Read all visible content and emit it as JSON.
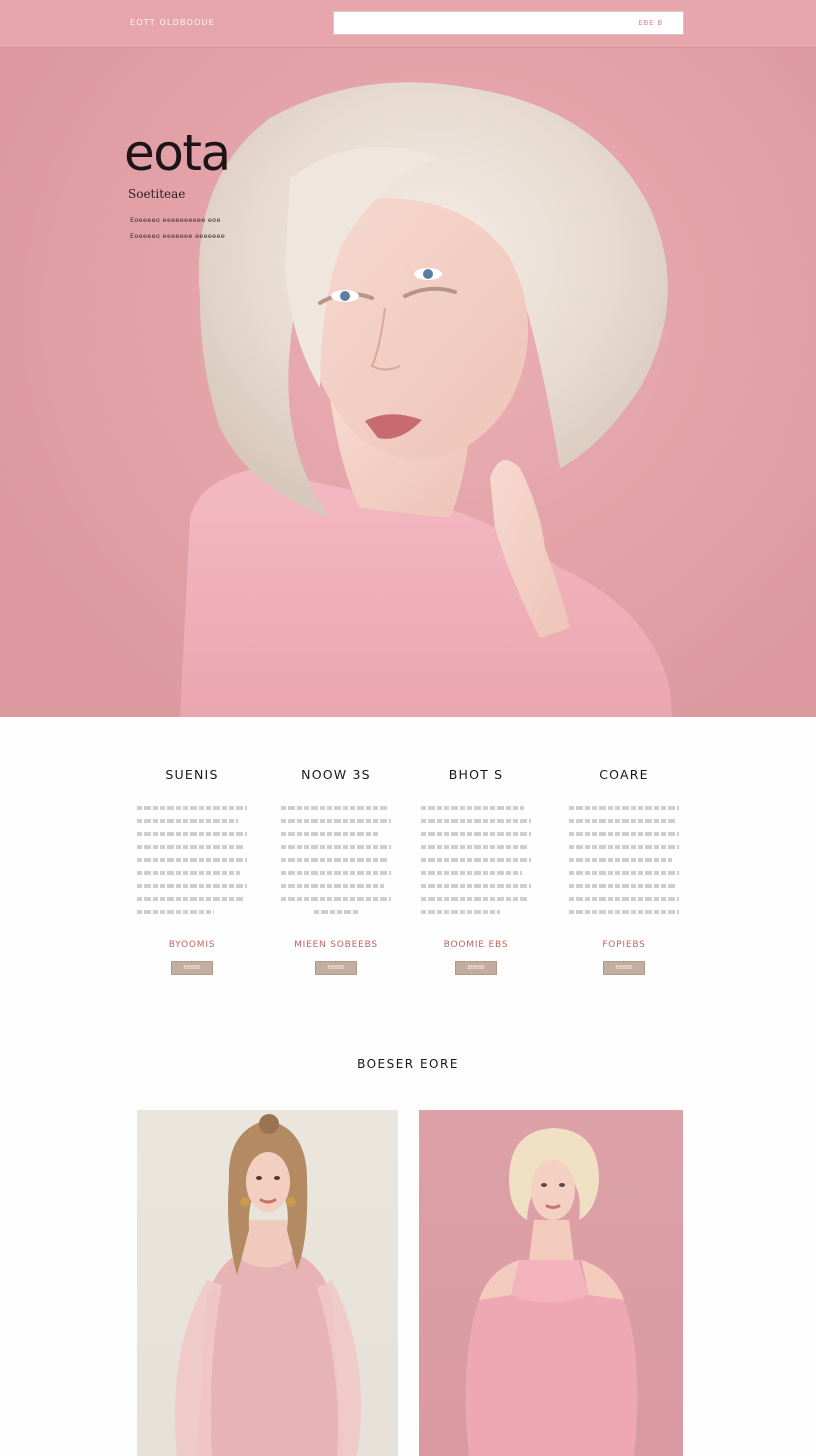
{
  "header": {
    "brand": "EOTT OLDBOOUE",
    "search_placeholder": "",
    "search_button": "EBE B"
  },
  "hero": {
    "logo": "eota",
    "tagline": "Soetiteae",
    "lines": [
      "Eoeeeeo eeeeeeeeee eoe",
      "Eoeeeeo eeeeeee eeeeeee"
    ]
  },
  "features": [
    {
      "title": "SUENIS",
      "link": "BYOOMIS",
      "button": "BBBBB"
    },
    {
      "title": "NOOW 3S",
      "link": "MIEEN SOBEEBS",
      "button": "BBBBB"
    },
    {
      "title": "BHOT S",
      "link": "BOOMIE EBS",
      "button": "BBBBB"
    },
    {
      "title": "COARE",
      "link": "FOPIEBS",
      "button": "BBBBB"
    }
  ],
  "gallery": {
    "title": "BOESER EORE"
  },
  "colors": {
    "header_bg": "#e6a6ac",
    "hero_bg": "#e3a3a8",
    "link": "#c4645f",
    "button_bg": "#c2ad9f",
    "card1_bg": "#eae6de",
    "card2_bg": "#dca1a7"
  }
}
